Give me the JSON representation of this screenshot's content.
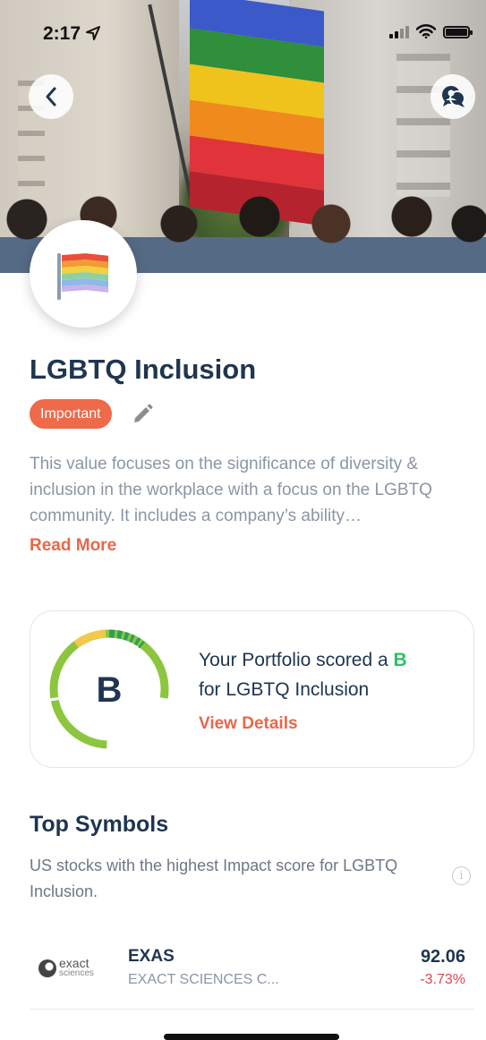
{
  "status_bar": {
    "time": "2:17"
  },
  "header": {
    "title": "LGBTQ Inclusion",
    "tag": "Important"
  },
  "description": {
    "text": "This value focuses on the significance of diversity & inclusion in the workplace with a focus on the LGBTQ community. It includes a company’s ability…",
    "read_more": "Read More"
  },
  "score_card": {
    "grade": "B",
    "text_before": "Your Portfolio scored a ",
    "grade_inline": "B",
    "text_after": "for LGBTQ Inclusion",
    "view_details": "View Details",
    "colors": {
      "green": "#8cc63f",
      "yellow": "#f2c94c",
      "dark_green": "#2e9e5a",
      "grade_text": "#2fbf6a"
    }
  },
  "top_symbols": {
    "title": "Top Symbols",
    "subtitle": "US stocks with the highest Impact score for LGBTQ Inclusion.",
    "items": [
      {
        "logo_word": "exact",
        "logo_sub": "sciences",
        "symbol": "EXAS",
        "name": "EXACT SCIENCES C...",
        "price": "92.06",
        "change": "-3.73%"
      }
    ]
  },
  "icons": [
    "back-arrow-icon",
    "support-chat-icon",
    "pride-flag-icon",
    "pencil-icon",
    "info-icon"
  ]
}
